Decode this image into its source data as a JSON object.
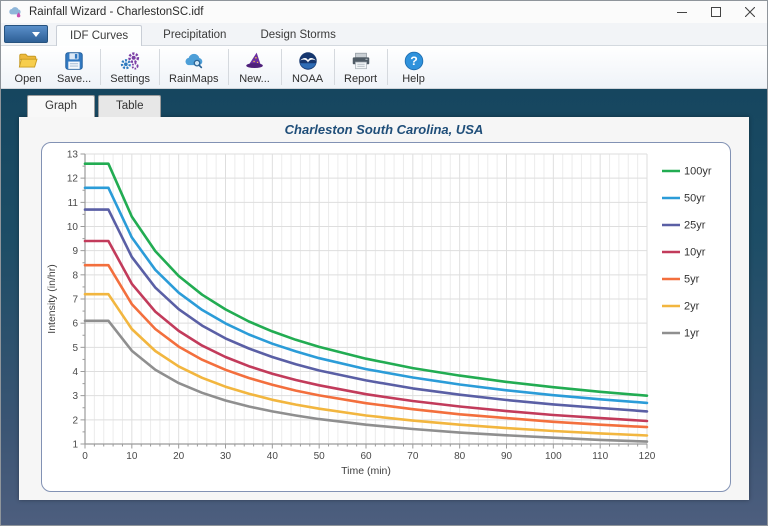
{
  "window": {
    "title": "Rainfall Wizard - CharlestonSC.idf"
  },
  "ribbon": {
    "tabs": [
      {
        "label": "IDF Curves",
        "active": true
      },
      {
        "label": "Precipitation",
        "active": false
      },
      {
        "label": "Design Storms",
        "active": false
      }
    ]
  },
  "toolbar": {
    "buttons": [
      {
        "label": "Open",
        "icon": "folder-open-icon"
      },
      {
        "label": "Save...",
        "icon": "floppy-disk-icon"
      },
      {
        "label": "Settings",
        "icon": "gears-icon"
      },
      {
        "label": "RainMaps",
        "icon": "cloud-search-icon"
      },
      {
        "label": "New...",
        "icon": "wizard-hat-icon"
      },
      {
        "label": "NOAA",
        "icon": "noaa-logo-icon"
      },
      {
        "label": "Report",
        "icon": "printer-icon"
      },
      {
        "label": "Help",
        "icon": "help-icon"
      }
    ]
  },
  "view_tabs": [
    {
      "label": "Graph",
      "active": true
    },
    {
      "label": "Table",
      "active": false
    }
  ],
  "chart_data": {
    "type": "line",
    "title": "Charleston South Carolina, USA",
    "title_color": "#1F4E79",
    "xlabel": "Time (min)",
    "ylabel": "Intensity (in/hr)",
    "xlim": [
      0,
      120
    ],
    "ylim": [
      1,
      13
    ],
    "x_ticks": [
      0,
      10,
      20,
      30,
      40,
      50,
      60,
      70,
      80,
      90,
      100,
      110,
      120
    ],
    "x_minor_step": 2,
    "y_ticks": [
      1,
      2,
      3,
      4,
      5,
      6,
      7,
      8,
      9,
      10,
      11,
      12,
      13
    ],
    "y_minor_step": 0.5,
    "grid": true,
    "legend_position": "right",
    "x": [
      0,
      5,
      10,
      15,
      20,
      25,
      30,
      35,
      40,
      45,
      50,
      60,
      70,
      80,
      90,
      100,
      110,
      120
    ],
    "series": [
      {
        "name": "100yr",
        "color": "#22ac52",
        "values": [
          12.6,
          12.6,
          10.41,
          8.98,
          7.95,
          7.18,
          6.57,
          6.07,
          5.66,
          5.31,
          5.02,
          4.53,
          4.14,
          3.83,
          3.57,
          3.35,
          3.16,
          3.0
        ]
      },
      {
        "name": "50yr",
        "color": "#2b9cd8",
        "values": [
          11.6,
          11.6,
          9.55,
          8.21,
          7.26,
          6.55,
          5.99,
          5.53,
          5.15,
          4.83,
          4.55,
          4.1,
          3.75,
          3.46,
          3.22,
          3.02,
          2.85,
          2.7
        ]
      },
      {
        "name": "25yr",
        "color": "#5a5fa5",
        "values": [
          10.7,
          10.7,
          8.74,
          7.47,
          6.58,
          5.9,
          5.37,
          4.95,
          4.6,
          4.3,
          4.04,
          3.63,
          3.3,
          3.04,
          2.82,
          2.64,
          2.49,
          2.35
        ]
      },
      {
        "name": "10yr",
        "color": "#c23b5b",
        "values": [
          9.4,
          9.4,
          7.63,
          6.48,
          5.68,
          5.07,
          4.6,
          4.22,
          3.91,
          3.65,
          3.43,
          3.06,
          2.78,
          2.55,
          2.36,
          2.2,
          2.07,
          1.95
        ]
      },
      {
        "name": "5yr",
        "color": "#f36f3d",
        "values": [
          8.4,
          8.4,
          6.79,
          5.76,
          5.03,
          4.49,
          4.07,
          3.73,
          3.45,
          3.21,
          3.01,
          2.69,
          2.44,
          2.23,
          2.07,
          1.92,
          1.8,
          1.7
        ]
      },
      {
        "name": "2yr",
        "color": "#f2b63f",
        "values": [
          7.2,
          7.2,
          5.76,
          4.85,
          4.21,
          3.74,
          3.37,
          3.08,
          2.83,
          2.63,
          2.46,
          2.18,
          1.97,
          1.8,
          1.66,
          1.54,
          1.44,
          1.35
        ]
      },
      {
        "name": "1yr",
        "color": "#8f8f8f",
        "values": [
          6.1,
          6.1,
          4.86,
          4.07,
          3.52,
          3.12,
          2.8,
          2.55,
          2.35,
          2.18,
          2.03,
          1.8,
          1.62,
          1.47,
          1.36,
          1.26,
          1.17,
          1.1
        ]
      }
    ]
  }
}
